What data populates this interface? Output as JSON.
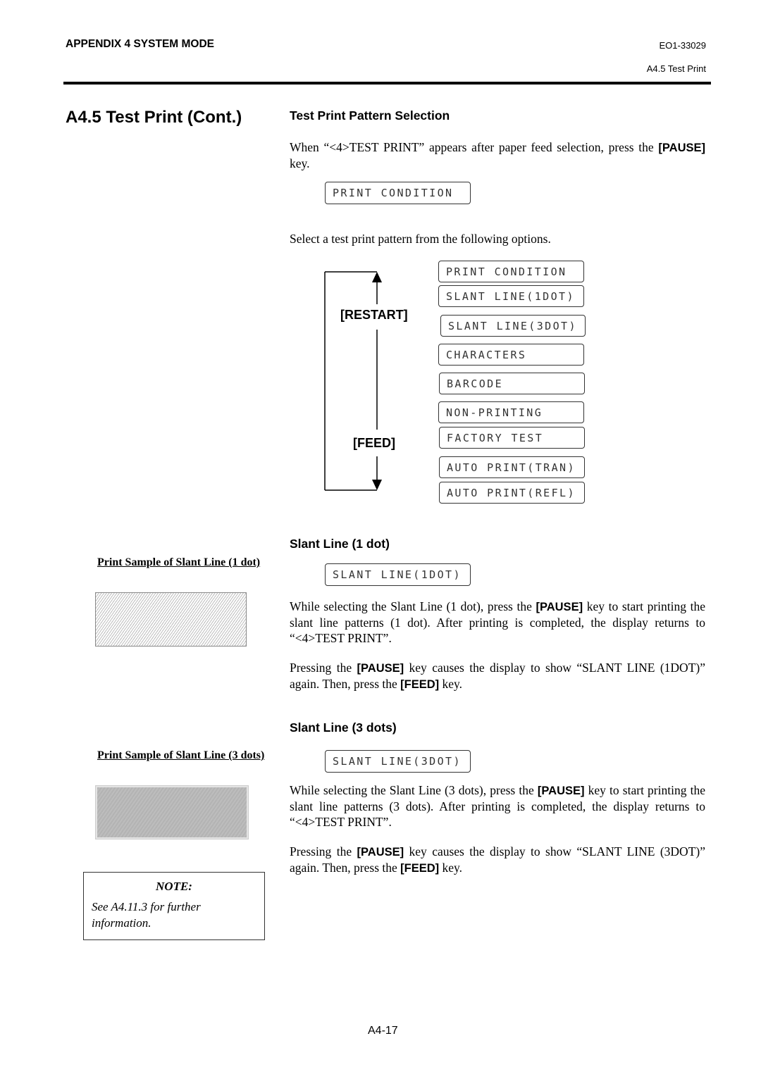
{
  "header": {
    "chapter": "APPENDIX 4 SYSTEM MODE",
    "doc_number": "EO1-33029",
    "section": "A4.5 Test Print"
  },
  "page_title": "A4.5  Test Print (Cont.)",
  "selection": {
    "heading": "Test Print Pattern Selection",
    "intro_pre": "When “<4>TEST PRINT” appears after paper feed selection, press the ",
    "intro_key": "[PAUSE]",
    "intro_post": " key.",
    "display": "PRINT CONDITION",
    "select_text": "Select a test print pattern from the following options.",
    "restart_label": "[RESTART]",
    "feed_label": "[FEED]",
    "options": [
      "PRINT CONDITION",
      "SLANT LINE(1DOT)",
      "SLANT LINE(3DOT)",
      "CHARACTERS",
      "BARCODE",
      "NON-PRINTING",
      "FACTORY TEST",
      "AUTO PRINT(TRAN)",
      "AUTO PRINT(REFL)"
    ]
  },
  "slant1": {
    "heading": "Slant Line (1 dot)",
    "display": "SLANT LINE(1DOT)",
    "p1_a": "While selecting the Slant Line (1 dot), press the ",
    "p1_key": "[PAUSE]",
    "p1_b": " key to start printing the slant line patterns (1 dot).  After printing is completed, the display returns to “<4>TEST PRINT”.",
    "p2_a": "Pressing the ",
    "p2_key1": "[PAUSE]",
    "p2_b": " key causes the display to show “SLANT LINE (1DOT)” again.  Then, press the ",
    "p2_key2": "[FEED]",
    "p2_c": " key.",
    "sample_caption": "Print Sample of Slant Line (1 dot)"
  },
  "slant3": {
    "heading": "Slant Line (3 dots)",
    "display": "SLANT LINE(3DOT)",
    "p1_a": "While selecting the Slant Line (3 dots), press the ",
    "p1_key": "[PAUSE]",
    "p1_b": " key to start printing the slant line patterns (3 dots).  After printing is completed, the display returns to “<4>TEST PRINT”.",
    "p2_a": "Pressing the ",
    "p2_key1": "[PAUSE]",
    "p2_b": " key causes the display to show “SLANT LINE (3DOT)” again.  Then, press the ",
    "p2_key2": "[FEED]",
    "p2_c": " key.",
    "sample_caption": "Print Sample of Slant Line (3 dots)"
  },
  "note": {
    "title": "NOTE:",
    "text": "See A4.11.3 for further information."
  },
  "footer": {
    "page_number": "A4-17"
  }
}
